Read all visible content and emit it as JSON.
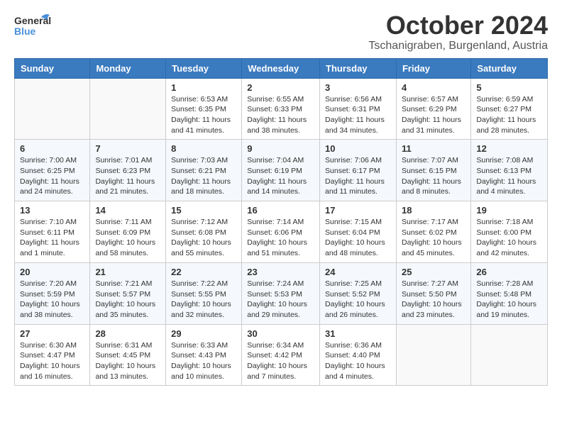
{
  "header": {
    "logo_general": "General",
    "logo_blue": "Blue",
    "month": "October 2024",
    "location": "Tschanigraben, Burgenland, Austria"
  },
  "weekdays": [
    "Sunday",
    "Monday",
    "Tuesday",
    "Wednesday",
    "Thursday",
    "Friday",
    "Saturday"
  ],
  "weeks": [
    [
      null,
      null,
      {
        "day": "1",
        "sunrise": "Sunrise: 6:53 AM",
        "sunset": "Sunset: 6:35 PM",
        "daylight": "Daylight: 11 hours and 41 minutes."
      },
      {
        "day": "2",
        "sunrise": "Sunrise: 6:55 AM",
        "sunset": "Sunset: 6:33 PM",
        "daylight": "Daylight: 11 hours and 38 minutes."
      },
      {
        "day": "3",
        "sunrise": "Sunrise: 6:56 AM",
        "sunset": "Sunset: 6:31 PM",
        "daylight": "Daylight: 11 hours and 34 minutes."
      },
      {
        "day": "4",
        "sunrise": "Sunrise: 6:57 AM",
        "sunset": "Sunset: 6:29 PM",
        "daylight": "Daylight: 11 hours and 31 minutes."
      },
      {
        "day": "5",
        "sunrise": "Sunrise: 6:59 AM",
        "sunset": "Sunset: 6:27 PM",
        "daylight": "Daylight: 11 hours and 28 minutes."
      }
    ],
    [
      {
        "day": "6",
        "sunrise": "Sunrise: 7:00 AM",
        "sunset": "Sunset: 6:25 PM",
        "daylight": "Daylight: 11 hours and 24 minutes."
      },
      {
        "day": "7",
        "sunrise": "Sunrise: 7:01 AM",
        "sunset": "Sunset: 6:23 PM",
        "daylight": "Daylight: 11 hours and 21 minutes."
      },
      {
        "day": "8",
        "sunrise": "Sunrise: 7:03 AM",
        "sunset": "Sunset: 6:21 PM",
        "daylight": "Daylight: 11 hours and 18 minutes."
      },
      {
        "day": "9",
        "sunrise": "Sunrise: 7:04 AM",
        "sunset": "Sunset: 6:19 PM",
        "daylight": "Daylight: 11 hours and 14 minutes."
      },
      {
        "day": "10",
        "sunrise": "Sunrise: 7:06 AM",
        "sunset": "Sunset: 6:17 PM",
        "daylight": "Daylight: 11 hours and 11 minutes."
      },
      {
        "day": "11",
        "sunrise": "Sunrise: 7:07 AM",
        "sunset": "Sunset: 6:15 PM",
        "daylight": "Daylight: 11 hours and 8 minutes."
      },
      {
        "day": "12",
        "sunrise": "Sunrise: 7:08 AM",
        "sunset": "Sunset: 6:13 PM",
        "daylight": "Daylight: 11 hours and 4 minutes."
      }
    ],
    [
      {
        "day": "13",
        "sunrise": "Sunrise: 7:10 AM",
        "sunset": "Sunset: 6:11 PM",
        "daylight": "Daylight: 11 hours and 1 minute."
      },
      {
        "day": "14",
        "sunrise": "Sunrise: 7:11 AM",
        "sunset": "Sunset: 6:09 PM",
        "daylight": "Daylight: 10 hours and 58 minutes."
      },
      {
        "day": "15",
        "sunrise": "Sunrise: 7:12 AM",
        "sunset": "Sunset: 6:08 PM",
        "daylight": "Daylight: 10 hours and 55 minutes."
      },
      {
        "day": "16",
        "sunrise": "Sunrise: 7:14 AM",
        "sunset": "Sunset: 6:06 PM",
        "daylight": "Daylight: 10 hours and 51 minutes."
      },
      {
        "day": "17",
        "sunrise": "Sunrise: 7:15 AM",
        "sunset": "Sunset: 6:04 PM",
        "daylight": "Daylight: 10 hours and 48 minutes."
      },
      {
        "day": "18",
        "sunrise": "Sunrise: 7:17 AM",
        "sunset": "Sunset: 6:02 PM",
        "daylight": "Daylight: 10 hours and 45 minutes."
      },
      {
        "day": "19",
        "sunrise": "Sunrise: 7:18 AM",
        "sunset": "Sunset: 6:00 PM",
        "daylight": "Daylight: 10 hours and 42 minutes."
      }
    ],
    [
      {
        "day": "20",
        "sunrise": "Sunrise: 7:20 AM",
        "sunset": "Sunset: 5:59 PM",
        "daylight": "Daylight: 10 hours and 38 minutes."
      },
      {
        "day": "21",
        "sunrise": "Sunrise: 7:21 AM",
        "sunset": "Sunset: 5:57 PM",
        "daylight": "Daylight: 10 hours and 35 minutes."
      },
      {
        "day": "22",
        "sunrise": "Sunrise: 7:22 AM",
        "sunset": "Sunset: 5:55 PM",
        "daylight": "Daylight: 10 hours and 32 minutes."
      },
      {
        "day": "23",
        "sunrise": "Sunrise: 7:24 AM",
        "sunset": "Sunset: 5:53 PM",
        "daylight": "Daylight: 10 hours and 29 minutes."
      },
      {
        "day": "24",
        "sunrise": "Sunrise: 7:25 AM",
        "sunset": "Sunset: 5:52 PM",
        "daylight": "Daylight: 10 hours and 26 minutes."
      },
      {
        "day": "25",
        "sunrise": "Sunrise: 7:27 AM",
        "sunset": "Sunset: 5:50 PM",
        "daylight": "Daylight: 10 hours and 23 minutes."
      },
      {
        "day": "26",
        "sunrise": "Sunrise: 7:28 AM",
        "sunset": "Sunset: 5:48 PM",
        "daylight": "Daylight: 10 hours and 19 minutes."
      }
    ],
    [
      {
        "day": "27",
        "sunrise": "Sunrise: 6:30 AM",
        "sunset": "Sunset: 4:47 PM",
        "daylight": "Daylight: 10 hours and 16 minutes."
      },
      {
        "day": "28",
        "sunrise": "Sunrise: 6:31 AM",
        "sunset": "Sunset: 4:45 PM",
        "daylight": "Daylight: 10 hours and 13 minutes."
      },
      {
        "day": "29",
        "sunrise": "Sunrise: 6:33 AM",
        "sunset": "Sunset: 4:43 PM",
        "daylight": "Daylight: 10 hours and 10 minutes."
      },
      {
        "day": "30",
        "sunrise": "Sunrise: 6:34 AM",
        "sunset": "Sunset: 4:42 PM",
        "daylight": "Daylight: 10 hours and 7 minutes."
      },
      {
        "day": "31",
        "sunrise": "Sunrise: 6:36 AM",
        "sunset": "Sunset: 4:40 PM",
        "daylight": "Daylight: 10 hours and 4 minutes."
      },
      null,
      null
    ]
  ]
}
